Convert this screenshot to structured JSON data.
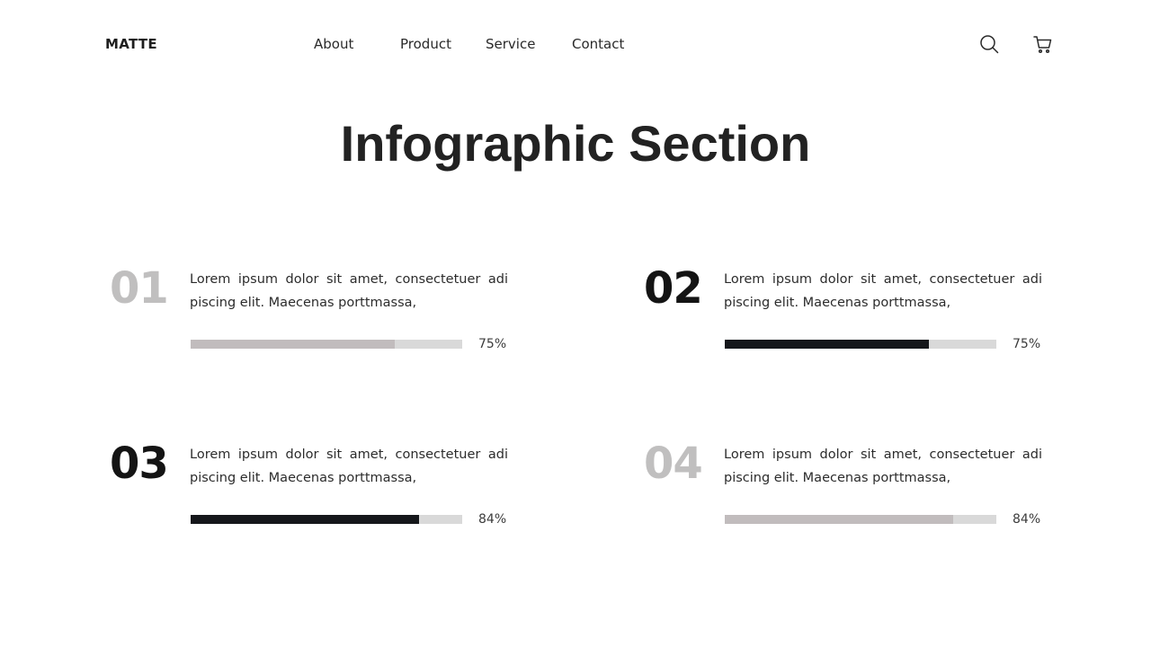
{
  "header": {
    "logo": "MATTE",
    "nav": [
      "About",
      "Product",
      "Service",
      "Contact"
    ],
    "icons": [
      "search-icon",
      "cart-icon"
    ]
  },
  "main": {
    "title": "Infographic Section",
    "stats": [
      {
        "number": "01",
        "text": "Lorem ipsum dolor sit amet, consectetuer adi piscing elit. Maecenas porttmassa,",
        "percent_label": "75%",
        "value": 0.75,
        "number_color": "#c0bfbf",
        "bar_color": "#c1bcbd"
      },
      {
        "number": "02",
        "text": "Lorem ipsum dolor sit amet, consectetuer adi piscing elit. Maecenas porttmassa,",
        "percent_label": "75%",
        "value": 0.75,
        "number_color": "#141414",
        "bar_color": "#15171b"
      },
      {
        "number": "03",
        "text": "Lorem ipsum dolor sit amet, consectetuer adi piscing elit. Maecenas porttmassa,",
        "percent_label": "84%",
        "value": 0.84,
        "number_color": "#141414",
        "bar_color": "#15171b"
      },
      {
        "number": "04",
        "text": "Lorem ipsum dolor sit amet, consectetuer adi piscing elit. Maecenas porttmassa,",
        "percent_label": "84%",
        "value": 0.84,
        "number_color": "#c0bfbf",
        "bar_color": "#c1bcbd"
      }
    ]
  },
  "colors": {
    "background": "#ffffff",
    "text": "#222222",
    "bar_track": "#d9d9d9"
  }
}
